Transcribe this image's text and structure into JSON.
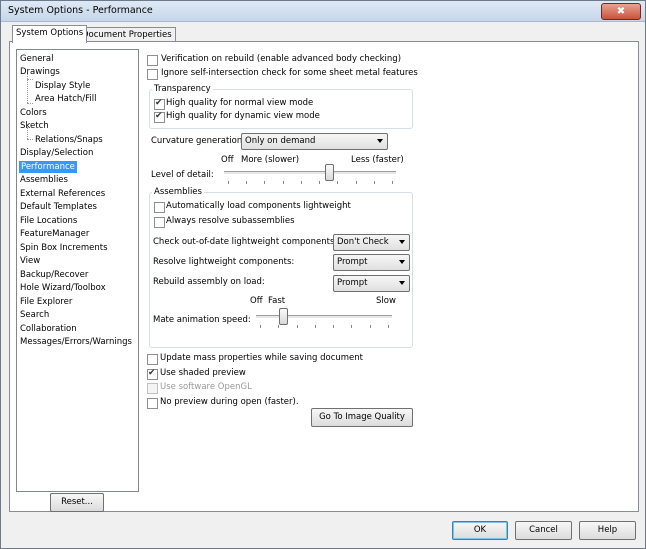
{
  "window": {
    "title": "System Options - Performance",
    "close_glyph": "✖"
  },
  "tabs": [
    {
      "label": "System Options",
      "active": true
    },
    {
      "label": "Document Properties",
      "active": false
    }
  ],
  "tree": {
    "items": [
      {
        "label": "General"
      },
      {
        "label": "Drawings"
      },
      {
        "label": "Display Style",
        "child": true
      },
      {
        "label": "Area Hatch/Fill",
        "child": true
      },
      {
        "label": "Colors"
      },
      {
        "label": "Sketch"
      },
      {
        "label": "Relations/Snaps",
        "child": true
      },
      {
        "label": "Display/Selection"
      },
      {
        "label": "Performance",
        "selected": true
      },
      {
        "label": "Assemblies"
      },
      {
        "label": "External References"
      },
      {
        "label": "Default Templates"
      },
      {
        "label": "File Locations"
      },
      {
        "label": "FeatureManager"
      },
      {
        "label": "Spin Box Increments"
      },
      {
        "label": "View"
      },
      {
        "label": "Backup/Recover"
      },
      {
        "label": "Hole Wizard/Toolbox"
      },
      {
        "label": "File Explorer"
      },
      {
        "label": "Search"
      },
      {
        "label": "Collaboration"
      },
      {
        "label": "Messages/Errors/Warnings"
      }
    ],
    "reset_label": "Reset..."
  },
  "options": {
    "verification": {
      "label": "Verification on rebuild (enable advanced body checking)",
      "checked": false
    },
    "ignore_self_intersection": {
      "label": "Ignore self-intersection check for some sheet metal features",
      "checked": false
    }
  },
  "transparency": {
    "title": "Transparency",
    "normal": {
      "label": "High quality for normal view mode",
      "checked": true
    },
    "dynamic": {
      "label": "High quality for dynamic view mode",
      "checked": true
    }
  },
  "curvature": {
    "label": "Curvature generation:",
    "value": "Only on demand"
  },
  "level_of_detail": {
    "label": "Level of detail:",
    "left_label": "Off",
    "mid_label": "More (slower)",
    "right_label": "Less (faster)",
    "position_fraction": 0.62
  },
  "assemblies": {
    "title": "Assemblies",
    "auto_lightweight": {
      "label": "Automatically load components lightweight",
      "checked": false
    },
    "always_resolve": {
      "label": "Always resolve subassemblies",
      "checked": false
    },
    "check_out_of_date": {
      "label": "Check out-of-date lightweight components:",
      "value": "Don't Check"
    },
    "resolve_lightweight": {
      "label": "Resolve lightweight components:",
      "value": "Prompt"
    },
    "rebuild_on_load": {
      "label": "Rebuild assembly on load:",
      "value": "Prompt"
    },
    "mate_animation": {
      "label": "Mate animation speed:",
      "left_label": "Off",
      "mid_label": "Fast",
      "right_label": "Slow",
      "position_fraction": 0.18
    }
  },
  "bottom_options": {
    "update_mass": {
      "label": "Update mass properties while saving document",
      "checked": false,
      "disabled": false
    },
    "shaded_preview": {
      "label": "Use shaded preview",
      "checked": true,
      "disabled": false
    },
    "software_opengl": {
      "label": "Use software OpenGL",
      "checked": false,
      "disabled": true
    },
    "no_preview": {
      "label": "No preview during open (faster).",
      "checked": false,
      "disabled": false
    }
  },
  "image_quality_button": "Go To Image Quality",
  "footer": {
    "ok": "OK",
    "cancel": "Cancel",
    "help": "Help"
  }
}
